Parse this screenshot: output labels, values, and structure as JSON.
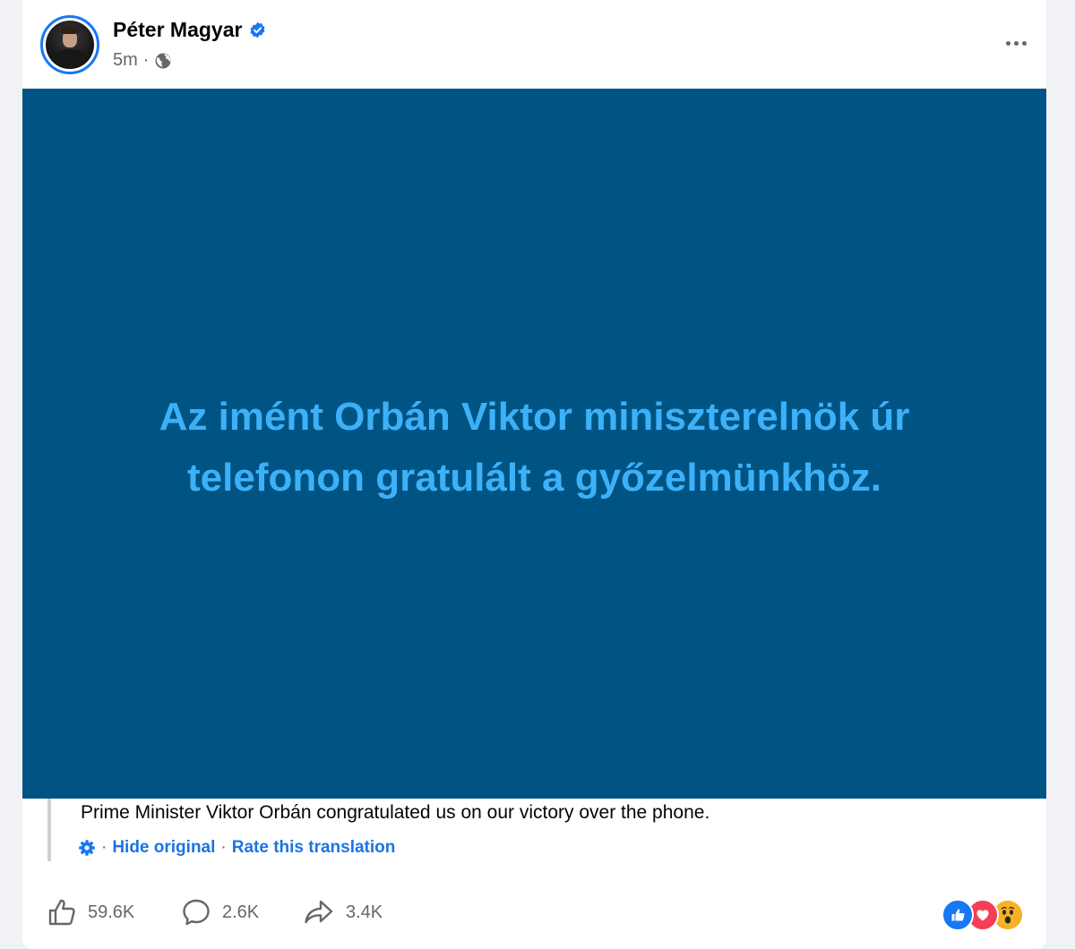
{
  "post": {
    "author": "Péter Magyar",
    "time": "5m",
    "separator": "·",
    "media_text": "Az imént Orbán Viktor miniszterelnök úr telefonon gratulált a győzelmünkhöz.",
    "translation": "Prime Minister Viktor Orbán congratulated us on our victory over the phone.",
    "hide_original": "Hide original",
    "rate_translation": "Rate this translation"
  },
  "stats": {
    "likes": "59.6K",
    "comments": "2.6K",
    "shares": "3.4K"
  },
  "icons": {
    "verified": "verified-badge-icon",
    "audience": "globe-icon",
    "more": "more-options-icon",
    "translation_settings": "gear-icon",
    "like": "thumbs-up-icon",
    "comment": "comment-bubble-icon",
    "share": "share-arrow-icon"
  },
  "colors": {
    "brand_blue": "#1877f2",
    "media_background": "#005484",
    "media_text": "#3db1f8",
    "muted_text": "#65676b"
  }
}
